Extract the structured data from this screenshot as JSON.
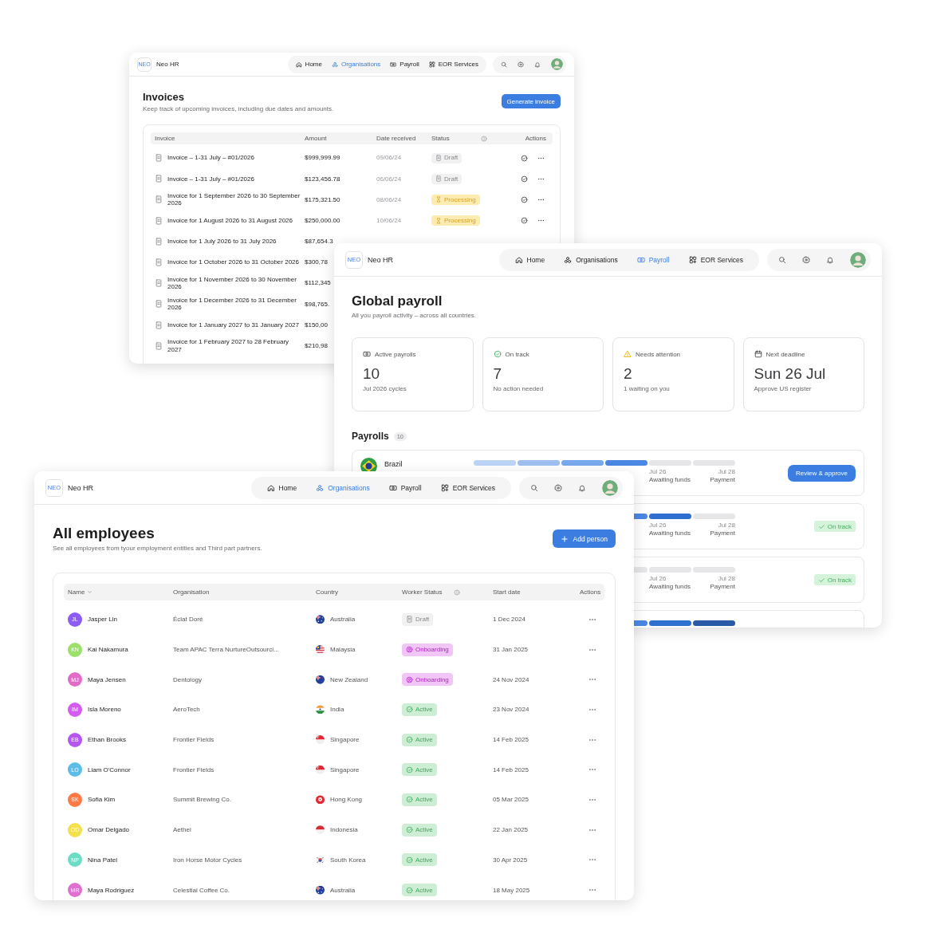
{
  "invoices_window": {
    "brand": {
      "logo": "NEO",
      "name": "Neo HR"
    },
    "nav": [
      {
        "kind": "home",
        "label": "Home",
        "selected": false
      },
      {
        "kind": "group",
        "label": "Organisations",
        "selected": true
      },
      {
        "kind": "banknote",
        "label": "Payroll",
        "selected": false
      },
      {
        "kind": "grid",
        "label": "EOR Services",
        "selected": false
      }
    ],
    "title": "Invoices",
    "subtitle": "Keep track of upcoming invoices, including due dates and amounts.",
    "button": "Generate invoice",
    "table": {
      "columns": [
        {
          "label": "Invoice",
          "info": false
        },
        {
          "label": "Amount",
          "info": false
        },
        {
          "label": "Date received",
          "info": false
        },
        {
          "label": "Status",
          "info": true
        },
        {
          "label": "Actions",
          "info": false
        }
      ],
      "rows": [
        {
          "invoice": "Invoice – 1-31 July – #01/2026",
          "amount": "$999,999.99",
          "date": "09/06/24",
          "status": {
            "kind": "draft",
            "label": "Draft"
          }
        },
        {
          "invoice": "Invoice – 1-31 July – #01/2026",
          "amount": "$123,456.78",
          "date": "06/06/24",
          "status": {
            "kind": "draft",
            "label": "Draft"
          }
        },
        {
          "invoice": "Invoice for 1 September 2026 to 30 September 2026",
          "amount": "$175,321.50",
          "date": "08/06/24",
          "status": {
            "kind": "processing",
            "label": "Processing"
          }
        },
        {
          "invoice": "Invoice for 1 August 2026 to 31 August 2026",
          "amount": "$250,000.00",
          "date": "10/06/24",
          "status": {
            "kind": "processing",
            "label": "Processing"
          }
        },
        {
          "invoice": "Invoice for 1 July 2026 to 31 July 2026",
          "amount": "$87,654.3"
        },
        {
          "invoice": "Invoice for 1 October 2026 to 31 October 2026",
          "amount": "$300,78"
        },
        {
          "invoice": "Invoice for 1 November 2026 to 30 November 2026",
          "amount": "$112,345"
        },
        {
          "invoice": "Invoice for 1 December 2026 to 31 December 2026",
          "amount": "$98,765."
        },
        {
          "invoice": "Invoice for 1 January 2027 to 31 January 2027",
          "amount": "$150,00"
        },
        {
          "invoice": "Invoice for 1 February 2027 to 28 February 2027",
          "amount": "$210,98"
        }
      ]
    }
  },
  "payroll_window": {
    "brand": {
      "logo": "NEO",
      "name": "Neo HR"
    },
    "nav": [
      {
        "kind": "home",
        "label": "Home",
        "selected": false
      },
      {
        "kind": "group",
        "label": "Organisations",
        "selected": false
      },
      {
        "kind": "banknote",
        "label": "Payroll",
        "selected": true
      },
      {
        "kind": "grid",
        "label": "EOR Services",
        "selected": false
      }
    ],
    "title": "Global payroll",
    "subtitle": "All you payroll activity – across all countries.",
    "stats": [
      {
        "kind": "banknote",
        "label": "Active payrolls",
        "value": "10",
        "note": "Jul 2026 cycles"
      },
      {
        "kind": "check-circle",
        "label": "On track",
        "value": "7",
        "note": "No action needed"
      },
      {
        "kind": "warning",
        "label": "Needs attention",
        "value": "2",
        "note": "1 waiting on you"
      },
      {
        "kind": "calendar",
        "label": "Next deadline",
        "value": "Sun 26 Jul",
        "note": "Approve US register"
      }
    ],
    "payrolls": {
      "title": "Payrolls",
      "count": "10",
      "rows": [
        {
          "country": "Brazil",
          "flag": {
            "kind": "brazil"
          },
          "steps": [
            {
              "complete": true
            },
            {
              "complete": true
            },
            {
              "complete": true
            },
            {
              "complete": true
            },
            {
              "complete": false,
              "date": "Jul 26",
              "label": "Awaiting funds"
            },
            {
              "complete": false,
              "date": "Jul 28",
              "label": "Payment"
            }
          ],
          "action": {
            "kind": "button",
            "label": "Review & approve"
          }
        },
        {
          "steps": [
            {
              "complete": true
            },
            {
              "complete": true,
              "date": "Jul 26",
              "label": "Awaiting funds"
            },
            {
              "complete": false,
              "date": "Jul 28",
              "label": "Payment"
            }
          ],
          "action": {
            "kind": "badge",
            "label": "On track"
          }
        },
        {
          "steps": [
            {
              "complete": false
            },
            {
              "complete": false,
              "date": "Jul 26",
              "label": "Awaiting funds"
            },
            {
              "complete": false,
              "date": "Jul 28",
              "label": "Payment"
            }
          ],
          "action": {
            "kind": "badge",
            "label": "On track"
          }
        },
        {
          "steps": [
            {
              "complete": true
            },
            {
              "complete": true
            },
            {
              "complete": true
            }
          ]
        }
      ]
    }
  },
  "employees_window": {
    "brand": {
      "logo": "NEO",
      "name": "Neo HR"
    },
    "nav": [
      {
        "kind": "home",
        "label": "Home",
        "selected": false
      },
      {
        "kind": "group",
        "label": "Organisations",
        "selected": true
      },
      {
        "kind": "banknote",
        "label": "Payroll",
        "selected": false
      },
      {
        "kind": "grid",
        "label": "EOR Services",
        "selected": false
      }
    ],
    "title": "All employees",
    "subtitle": "See all employees from tyour employment entities and Third part partners.",
    "button": "Add person",
    "table": {
      "columns": [
        {
          "label": "Name",
          "sortable": true,
          "info": false
        },
        {
          "label": "Organisation",
          "sortable": false,
          "info": false
        },
        {
          "label": "Country",
          "sortable": false,
          "info": false
        },
        {
          "label": "Worker Status",
          "sortable": false,
          "info": true
        },
        {
          "label": "Start date",
          "sortable": false,
          "info": false
        },
        {
          "label": "Actions",
          "sortable": false,
          "info": false
        }
      ],
      "rows": [
        {
          "initials": "JL",
          "color": "#8b5cf6",
          "name": "Jasper Lin",
          "organisation": "Éclat Doré",
          "flag": {
            "kind": "australia"
          },
          "country": "Australia",
          "status": {
            "kind": "draft",
            "label": "Draft"
          },
          "start": "1 Dec 2024"
        },
        {
          "initials": "KN",
          "color": "#9be06a",
          "name": "Kai Nakamura",
          "organisation": "Team APAC Terra NurtureOutsourci...",
          "flag": {
            "kind": "malaysia"
          },
          "country": "Malaysia",
          "status": {
            "kind": "onboarding",
            "label": "Onboarding"
          },
          "start": "31 Jan 2025"
        },
        {
          "initials": "MJ",
          "color": "#e46cc9",
          "name": "Maya Jensen",
          "organisation": "Dentology",
          "flag": {
            "kind": "new_zealand"
          },
          "country": "New Zealand",
          "status": {
            "kind": "onboarding",
            "label": "Onboarding"
          },
          "start": "24 Nov 2024"
        },
        {
          "initials": "IM",
          "color": "#d55cf0",
          "name": "Isla Moreno",
          "organisation": "AeroTech",
          "flag": {
            "kind": "india"
          },
          "country": "India",
          "status": {
            "kind": "active",
            "label": "Active"
          },
          "start": "23 Nov 2024"
        },
        {
          "initials": "EB",
          "color": "#b456ef",
          "name": "Ethan Brooks",
          "organisation": "Frontier Fields",
          "flag": {
            "kind": "singapore"
          },
          "country": "Singapore",
          "status": {
            "kind": "active",
            "label": "Active"
          },
          "start": "14 Feb 2025"
        },
        {
          "initials": "LO",
          "color": "#5cbde6",
          "name": "Liam O'Connor",
          "organisation": "Frontier Fields",
          "flag": {
            "kind": "singapore"
          },
          "country": "Singapore",
          "status": {
            "kind": "active",
            "label": "Active"
          },
          "start": "14 Feb 2025"
        },
        {
          "initials": "SK",
          "color": "#ff7a45",
          "name": "Sofia Kim",
          "organisation": "Summit Brewing Co.",
          "flag": {
            "kind": "hong_kong"
          },
          "country": "Hong Kong",
          "status": {
            "kind": "active",
            "label": "Active"
          },
          "start": "05 Mar 2025"
        },
        {
          "initials": "OD",
          "color": "#f4e04b",
          "name": "Omar Delgado",
          "organisation": "Aethel",
          "flag": {
            "kind": "indonesia"
          },
          "country": "Indonesia",
          "status": {
            "kind": "active",
            "label": "Active"
          },
          "start": "22 Jan 2025"
        },
        {
          "initials": "NP",
          "color": "#6ddcc4",
          "name": "Nina Patel",
          "organisation": "Iron Horse Motor Cycles",
          "flag": {
            "kind": "south_korea"
          },
          "country": "South Korea",
          "status": {
            "kind": "active",
            "label": "Active"
          },
          "start": "30 Apr 2025"
        },
        {
          "initials": "MR",
          "color": "#e070d0",
          "name": "Maya Rodriguez",
          "organisation": "Celestial Coffee Co.",
          "flag": {
            "kind": "australia"
          },
          "country": "Australia",
          "status": {
            "kind": "active",
            "label": "Active"
          },
          "start": "18 May 2025"
        }
      ]
    }
  }
}
